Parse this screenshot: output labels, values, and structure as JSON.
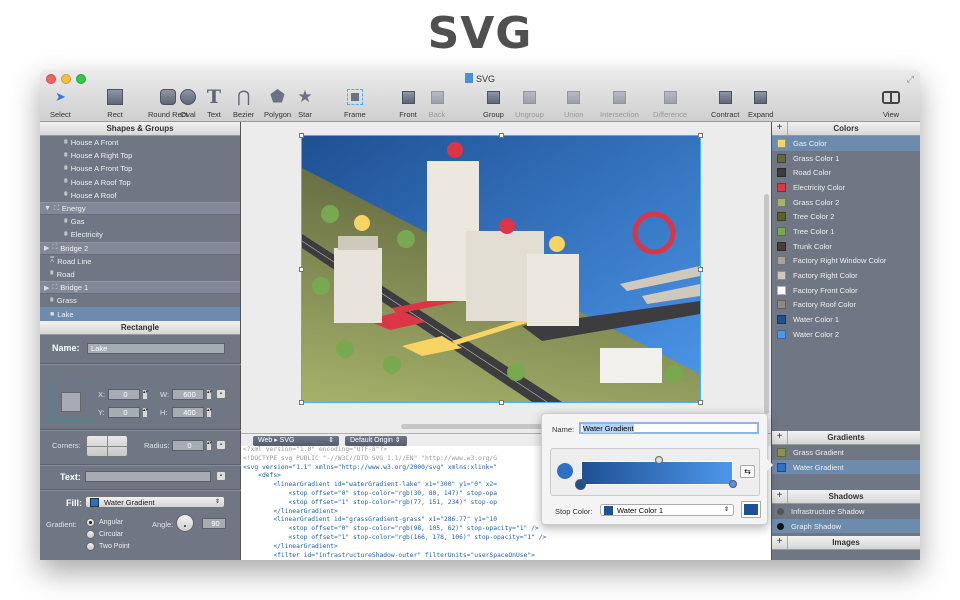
{
  "hero_title": "SVG",
  "window": {
    "title": "SVG"
  },
  "toolbar": {
    "tools": [
      {
        "label": "Select",
        "icon": "arrow-cursor-icon",
        "enabled": true
      },
      {
        "label": "Rect",
        "icon": "rectangle-icon",
        "enabled": true
      },
      {
        "label": "Round Rect",
        "icon": "rounded-rectangle-icon",
        "enabled": true
      },
      {
        "label": "Oval",
        "icon": "oval-icon",
        "enabled": true
      },
      {
        "label": "Text",
        "icon": "text-icon",
        "enabled": true
      },
      {
        "label": "Bezier",
        "icon": "bezier-icon",
        "enabled": true
      },
      {
        "label": "Polygon",
        "icon": "polygon-icon",
        "enabled": true
      },
      {
        "label": "Star",
        "icon": "star-icon",
        "enabled": true
      },
      {
        "label": "Frame",
        "icon": "frame-icon",
        "enabled": true
      },
      {
        "label": "Front",
        "icon": "bring-front-icon",
        "enabled": true
      },
      {
        "label": "Back",
        "icon": "send-back-icon",
        "enabled": false
      },
      {
        "label": "Group",
        "icon": "group-icon",
        "enabled": true
      },
      {
        "label": "Ungroup",
        "icon": "ungroup-icon",
        "enabled": false
      },
      {
        "label": "Union",
        "icon": "union-icon",
        "enabled": false
      },
      {
        "label": "Intersection",
        "icon": "intersection-icon",
        "enabled": false
      },
      {
        "label": "Difference",
        "icon": "difference-icon",
        "enabled": false
      },
      {
        "label": "Contract",
        "icon": "contract-icon",
        "enabled": true
      },
      {
        "label": "Expand",
        "icon": "expand-icon",
        "enabled": true
      },
      {
        "label": "View",
        "icon": "view-toggle-icon",
        "enabled": true
      }
    ]
  },
  "shapes_panel": {
    "title": "Shapes & Groups",
    "items": [
      {
        "label": "House A Front",
        "indent": 2,
        "type": "shape"
      },
      {
        "label": "House A Right Top",
        "indent": 2,
        "type": "shape"
      },
      {
        "label": "House A Front Top",
        "indent": 2,
        "type": "shape"
      },
      {
        "label": "House A Roof Top",
        "indent": 2,
        "type": "shape"
      },
      {
        "label": "House A Roof",
        "indent": 2,
        "type": "shape"
      },
      {
        "label": "Energy",
        "indent": 0,
        "type": "group",
        "expanded": true
      },
      {
        "label": "Gas",
        "indent": 2,
        "type": "shape"
      },
      {
        "label": "Electricity",
        "indent": 2,
        "type": "shape"
      },
      {
        "label": "Bridge 2",
        "indent": 0,
        "type": "group",
        "expanded": false
      },
      {
        "label": "Road Line",
        "indent": 1,
        "type": "path"
      },
      {
        "label": "Road",
        "indent": 1,
        "type": "shape"
      },
      {
        "label": "Bridge 1",
        "indent": 0,
        "type": "group",
        "expanded": false
      },
      {
        "label": "Grass",
        "indent": 1,
        "type": "shape"
      },
      {
        "label": "Lake",
        "indent": 1,
        "type": "rect",
        "selected": true
      }
    ]
  },
  "inspector": {
    "title": "Rectangle",
    "name_label": "Name:",
    "name_value": "Lake",
    "x_label": "X:",
    "x_value": "0",
    "y_label": "Y:",
    "y_value": "0",
    "w_label": "W:",
    "w_value": "600",
    "h_label": "H:",
    "h_value": "400",
    "corners_label": "Corners:",
    "radius_label": "Radius:",
    "radius_value": "0",
    "text_label": "Text:",
    "text_value": "",
    "fill_label": "Fill:",
    "fill_value": "Water Gradient",
    "fill_color": "#2f6fc4",
    "gradient_label": "Gradient:",
    "gradient_options": [
      "Angular",
      "Circular",
      "Two Point"
    ],
    "gradient_selected": "Angular",
    "angle_label": "Angle:",
    "angle_value": "90"
  },
  "code_panel": {
    "format_select": "Web ▸ SVG",
    "origin_select": "Default Origin",
    "lines": [
      {
        "text": "<?xml version=\"1.0\" encoding=\"UTF-8\"?>",
        "grey": true
      },
      {
        "text": "<!DOCTYPE svg PUBLIC \"-//W3C//DTD SVG 1.1//EN\" \"http://www.w3.org/G",
        "grey": true
      },
      {
        "text": "<svg version=\"1.1\" xmlns=\"http://www.w3.org/2000/svg\" xmlns:xlink=\"",
        "grey": false
      },
      {
        "text": "    <defs>",
        "grey": false
      },
      {
        "text": "        <linearGradient id=\"waterGradient-lake\" x1=\"300\" y1=\"0\" x2=",
        "grey": false
      },
      {
        "text": "            <stop offset=\"0\" stop-color=\"rgb(30, 80, 147)\" stop-opa",
        "grey": false
      },
      {
        "text": "            <stop offset=\"1\" stop-color=\"rgb(77, 151, 234)\" stop-op",
        "grey": false
      },
      {
        "text": "        </linearGradient>",
        "grey": false
      },
      {
        "text": "        <linearGradient id=\"grassGradient-grass\" x1=\"286.77\" y1=\"10",
        "grey": false
      },
      {
        "text": "            <stop offset=\"0\" stop-color=\"rgb(98, 105, 62)\" stop-opacity=\"1\" />",
        "grey": false
      },
      {
        "text": "            <stop offset=\"1\" stop-color=\"rgb(166, 178, 106)\" stop-opacity=\"1\" />",
        "grey": false
      },
      {
        "text": "        </linearGradient>",
        "grey": false
      },
      {
        "text": "        <filter id=\"infrastructureShadow-outer\" filterUnits=\"userSpaceOnUse\">",
        "grey": false
      }
    ]
  },
  "colors_panel": {
    "title": "Colors",
    "items": [
      {
        "label": "Gas Color",
        "color": "#f7d463",
        "selected": true
      },
      {
        "label": "Grass Color 1",
        "color": "#626940"
      },
      {
        "label": "Road Color",
        "color": "#3d3d3f"
      },
      {
        "label": "Electricity Color",
        "color": "#dc3545"
      },
      {
        "label": "Grass Color 2",
        "color": "#a6b26a"
      },
      {
        "label": "Tree Color 2",
        "color": "#5a6428"
      },
      {
        "label": "Tree Color 1",
        "color": "#78a850"
      },
      {
        "label": "Trunk Color",
        "color": "#4a3e30"
      },
      {
        "label": "Factory Right Window Color",
        "color": "#a8a298"
      },
      {
        "label": "Factory Right Color",
        "color": "#cfc8bc"
      },
      {
        "label": "Factory Front Color",
        "color": "#ffffff"
      },
      {
        "label": "Factory Roof Color",
        "color": "#8f8a80"
      },
      {
        "label": "Water Color 1",
        "color": "#1e5093"
      },
      {
        "label": "Water Color 2",
        "color": "#4d97ea"
      }
    ]
  },
  "gradients_panel": {
    "title": "Gradients",
    "items": [
      {
        "label": "Grass Gradient",
        "color": "#8a9450"
      },
      {
        "label": "Water Gradient",
        "color": "#2f6fc4",
        "selected": true
      }
    ]
  },
  "shadows_panel": {
    "title": "Shadows",
    "items": [
      {
        "label": "Infrastructure Shadow",
        "color": "#555"
      },
      {
        "label": "Graph Shadow",
        "color": "#111",
        "selected": true
      }
    ]
  },
  "images_panel": {
    "title": "Images"
  },
  "gradient_popover": {
    "name_label": "Name:",
    "name_value": "Water Gradient",
    "stop_color_label": "Stop Color:",
    "stop_color_value": "Water Color 1",
    "start_color": "#1e5093",
    "end_color": "#4d97ea"
  }
}
